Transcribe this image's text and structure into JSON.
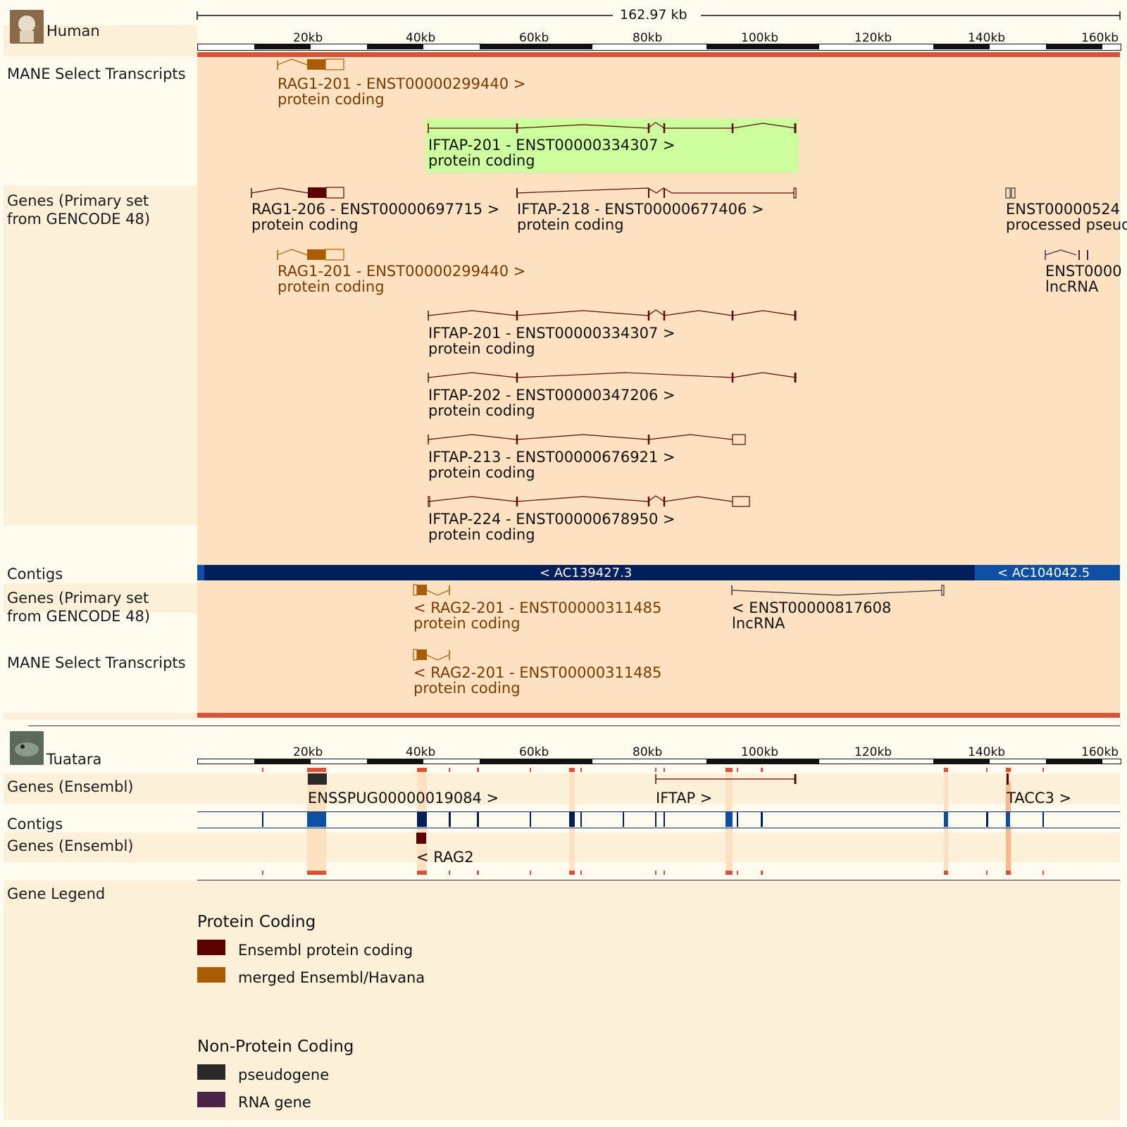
{
  "human": {
    "species": "Human",
    "length_label": "162.97 kb",
    "ruler_ticks": [
      "20kb",
      "40kb",
      "60kb",
      "80kb",
      "100kb",
      "120kb",
      "140kb",
      "160kb"
    ],
    "tracks": {
      "mane_top": "MANE Select Transcripts",
      "genes_top": "Genes (Primary set from GENCODE 48)",
      "contigs": "Contigs",
      "genes_bottom": "Genes (Primary set from GENCODE 48)",
      "mane_bottom": "MANE Select Transcripts"
    },
    "transcripts": [
      {
        "name": "RAG1-201 - ENST00000299440 >",
        "biotype": "protein coding"
      },
      {
        "name": "IFTAP-201 - ENST00000334307 >",
        "biotype": "protein coding"
      },
      {
        "name": "RAG1-206 - ENST00000697715 >",
        "biotype": "protein coding"
      },
      {
        "name": "IFTAP-218 - ENST00000677406 >",
        "biotype": "protein coding"
      },
      {
        "name": "ENST00000524",
        "biotype": "processed pseud"
      },
      {
        "name": "RAG1-201 - ENST00000299440 >",
        "biotype": "protein coding"
      },
      {
        "name": "ENST0000",
        "biotype": "lncRNA"
      },
      {
        "name": "IFTAP-201 - ENST00000334307 >",
        "biotype": "protein coding"
      },
      {
        "name": "IFTAP-202 - ENST00000347206 >",
        "biotype": "protein coding"
      },
      {
        "name": "IFTAP-213 - ENST00000676921 >",
        "biotype": "protein coding"
      },
      {
        "name": "IFTAP-224 - ENST00000678950 >",
        "biotype": "protein coding"
      },
      {
        "name": "< RAG2-201 - ENST00000311485",
        "biotype": "protein coding"
      },
      {
        "name": "< ENST00000817608",
        "biotype": "lncRNA"
      },
      {
        "name": "< RAG2-201 - ENST00000311485",
        "biotype": "protein coding"
      }
    ],
    "contigs": [
      "< AC139427.3",
      "< AC104042.5"
    ]
  },
  "tuatara": {
    "species": "Tuatara",
    "ruler_ticks": [
      "20kb",
      "40kb",
      "60kb",
      "80kb",
      "100kb",
      "120kb",
      "140kb",
      "160kb"
    ],
    "tracks": {
      "genes_top": "Genes (Ensembl)",
      "contigs": "Contigs",
      "genes_bottom": "Genes (Ensembl)"
    },
    "genes": [
      "ENSSPUG00000019084 >",
      "IFTAP >",
      "TACC3 >",
      "< RAG2"
    ]
  },
  "legend": {
    "title": "Gene Legend",
    "protein_heading": "Protein Coding",
    "protein_items": [
      {
        "label": "Ensembl protein coding",
        "color": "#5c0000"
      },
      {
        "label": "merged Ensembl/Havana",
        "color": "#a85d00"
      }
    ],
    "nonprotein_heading": "Non-Protein Coding",
    "nonprotein_items": [
      {
        "label": "pseudogene",
        "color": "#2a2a2a"
      },
      {
        "label": "RNA gene",
        "color": "#4a2548"
      }
    ]
  },
  "colors": {
    "highlight": "#fde1c1",
    "mane_green": "#cdff9e",
    "contig_dark": "#001f5c",
    "contig_blue": "#0d4fa3",
    "synteny_red": "#d9533b"
  }
}
